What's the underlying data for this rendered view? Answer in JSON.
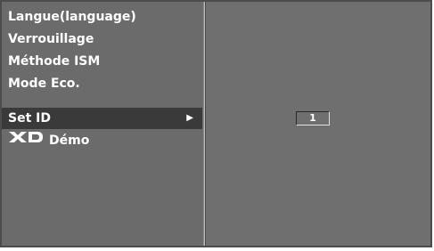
{
  "menu": {
    "items": [
      {
        "label": "Langue(language)",
        "selected": false
      },
      {
        "label": "Verrouillage",
        "selected": false
      },
      {
        "label": "Méthode ISM",
        "selected": false
      },
      {
        "label": "Mode Eco.",
        "selected": false
      },
      {
        "label": "Set ID",
        "selected": true,
        "has_submenu": true
      },
      {
        "label": "Démo",
        "selected": false,
        "icon": "xd-logo-icon",
        "logo_text": "XD"
      }
    ],
    "arrow_icon": "right-triangle-icon"
  },
  "set_id": {
    "value": "1"
  },
  "colors": {
    "panel_bg": "#6b6b6b",
    "selected_bg": "#3a3a3a",
    "text": "#ffffff"
  }
}
